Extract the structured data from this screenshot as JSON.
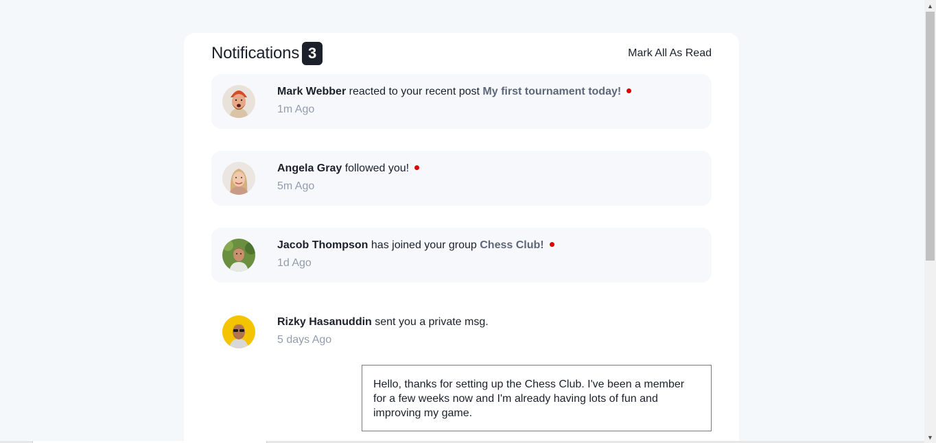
{
  "header": {
    "title": "Notifications",
    "unread_count": "3",
    "mark_all_label": "Mark All As Read"
  },
  "notifications": [
    {
      "name": "Mark Webber",
      "action": " reacted to your recent post ",
      "target": "My first tournament today!",
      "time": "1m Ago",
      "unread": true,
      "avatar": "avatar-mark-webber"
    },
    {
      "name": "Angela Gray",
      "action": " followed you!",
      "target": "",
      "time": "5m Ago",
      "unread": true,
      "avatar": "avatar-angela-gray"
    },
    {
      "name": "Jacob Thompson",
      "action": " has joined your group ",
      "target": "Chess Club!",
      "time": "1d Ago",
      "unread": true,
      "avatar": "avatar-jacob-thompson"
    },
    {
      "name": "Rizky Hasanuddin",
      "action": " sent you a private msg.",
      "target": "",
      "time": "5 days Ago",
      "unread": false,
      "avatar": "avatar-rizky-hasanuddin"
    }
  ],
  "private_message": "Hello, thanks for setting up the Chess Club. I've been a member for a few weeks now and I'm already having lots of fun and improving my game.",
  "colors": {
    "page_bg": "#f5f8fb",
    "card_bg": "#ffffff",
    "unread_bg": "#f6f8fb",
    "text_dark": "#1c202b",
    "text_link": "#5e6778",
    "text_muted": "#939cad",
    "unread_dot": "#e00000"
  },
  "icons": {
    "scroll_up": "▲",
    "scroll_down": "▼"
  }
}
